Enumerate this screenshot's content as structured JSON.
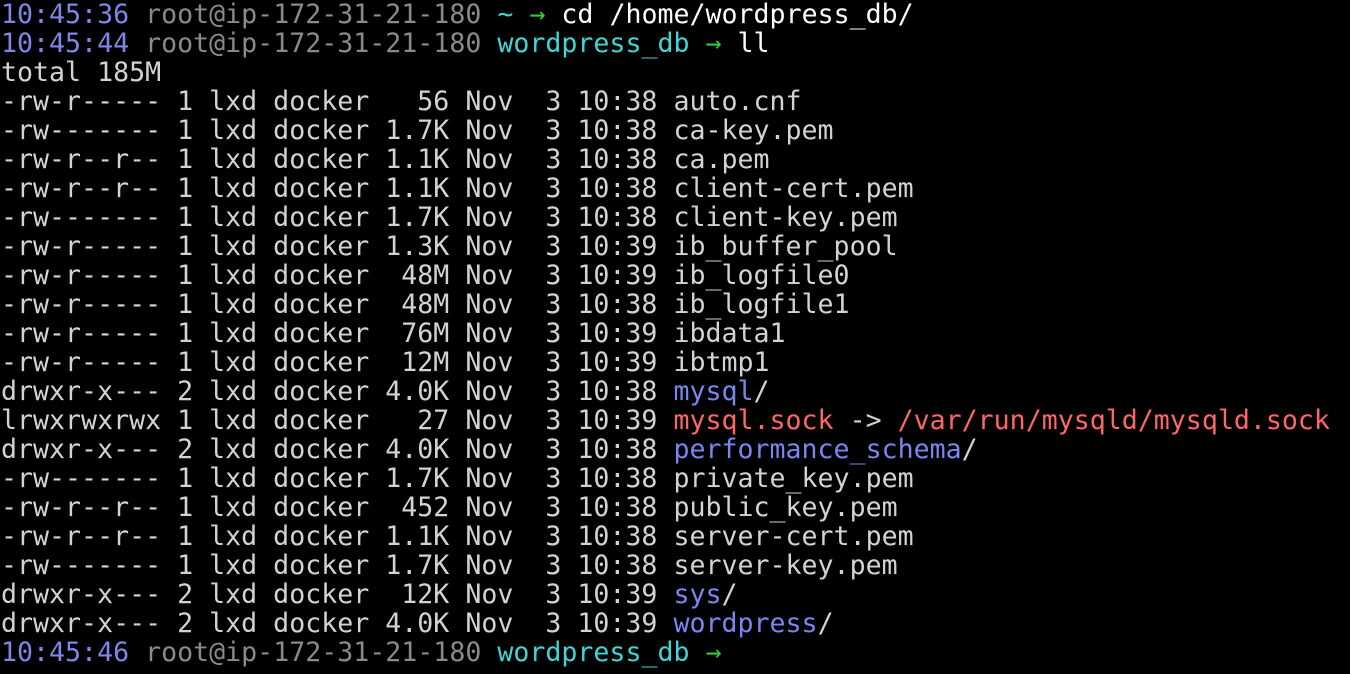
{
  "colors": {
    "background": "#000000",
    "text": "#d3d3d3",
    "time": "#7e86e8",
    "host": "#8a8a8a",
    "cwd": "#3fd6d6",
    "arrow": "#37c837",
    "directory": "#7a86f0",
    "symlink": "#ff6666"
  },
  "prompts": [
    {
      "time": "10:45:36",
      "host": "root@ip-172-31-21-180",
      "cwd": "~",
      "arrow": "→",
      "command": "cd /home/wordpress_db/"
    },
    {
      "time": "10:45:44",
      "host": "root@ip-172-31-21-180",
      "cwd": "wordpress_db",
      "arrow": "→",
      "command": "ll"
    },
    {
      "time": "10:45:46",
      "host": "root@ip-172-31-21-180",
      "cwd": "wordpress_db",
      "arrow": "→",
      "command": ""
    }
  ],
  "total_line": "total 185M",
  "listing": [
    {
      "meta": "-rw-r----- 1 lxd docker   56 Nov  3 10:38 ",
      "name": "auto.cnf",
      "kind": "file",
      "suffix": "",
      "target": ""
    },
    {
      "meta": "-rw------- 1 lxd docker 1.7K Nov  3 10:38 ",
      "name": "ca-key.pem",
      "kind": "file",
      "suffix": "",
      "target": ""
    },
    {
      "meta": "-rw-r--r-- 1 lxd docker 1.1K Nov  3 10:38 ",
      "name": "ca.pem",
      "kind": "file",
      "suffix": "",
      "target": ""
    },
    {
      "meta": "-rw-r--r-- 1 lxd docker 1.1K Nov  3 10:38 ",
      "name": "client-cert.pem",
      "kind": "file",
      "suffix": "",
      "target": ""
    },
    {
      "meta": "-rw------- 1 lxd docker 1.7K Nov  3 10:38 ",
      "name": "client-key.pem",
      "kind": "file",
      "suffix": "",
      "target": ""
    },
    {
      "meta": "-rw-r----- 1 lxd docker 1.3K Nov  3 10:39 ",
      "name": "ib_buffer_pool",
      "kind": "file",
      "suffix": "",
      "target": ""
    },
    {
      "meta": "-rw-r----- 1 lxd docker  48M Nov  3 10:39 ",
      "name": "ib_logfile0",
      "kind": "file",
      "suffix": "",
      "target": ""
    },
    {
      "meta": "-rw-r----- 1 lxd docker  48M Nov  3 10:38 ",
      "name": "ib_logfile1",
      "kind": "file",
      "suffix": "",
      "target": ""
    },
    {
      "meta": "-rw-r----- 1 lxd docker  76M Nov  3 10:39 ",
      "name": "ibdata1",
      "kind": "file",
      "suffix": "",
      "target": ""
    },
    {
      "meta": "-rw-r----- 1 lxd docker  12M Nov  3 10:39 ",
      "name": "ibtmp1",
      "kind": "file",
      "suffix": "",
      "target": ""
    },
    {
      "meta": "drwxr-x--- 2 lxd docker 4.0K Nov  3 10:38 ",
      "name": "mysql",
      "kind": "dir",
      "suffix": "/",
      "target": ""
    },
    {
      "meta": "lrwxrwxrwx 1 lxd docker   27 Nov  3 10:39 ",
      "name": "mysql.sock",
      "kind": "link",
      "suffix": " -> ",
      "target": "/var/run/mysqld/mysqld.sock"
    },
    {
      "meta": "drwxr-x--- 2 lxd docker 4.0K Nov  3 10:38 ",
      "name": "performance_schema",
      "kind": "dir",
      "suffix": "/",
      "target": ""
    },
    {
      "meta": "-rw------- 1 lxd docker 1.7K Nov  3 10:38 ",
      "name": "private_key.pem",
      "kind": "file",
      "suffix": "",
      "target": ""
    },
    {
      "meta": "-rw-r--r-- 1 lxd docker  452 Nov  3 10:38 ",
      "name": "public_key.pem",
      "kind": "file",
      "suffix": "",
      "target": ""
    },
    {
      "meta": "-rw-r--r-- 1 lxd docker 1.1K Nov  3 10:38 ",
      "name": "server-cert.pem",
      "kind": "file",
      "suffix": "",
      "target": ""
    },
    {
      "meta": "-rw------- 1 lxd docker 1.7K Nov  3 10:38 ",
      "name": "server-key.pem",
      "kind": "file",
      "suffix": "",
      "target": ""
    },
    {
      "meta": "drwxr-x--- 2 lxd docker  12K Nov  3 10:39 ",
      "name": "sys",
      "kind": "dir",
      "suffix": "/",
      "target": ""
    },
    {
      "meta": "drwxr-x--- 2 lxd docker 4.0K Nov  3 10:39 ",
      "name": "wordpress",
      "kind": "dir",
      "suffix": "/",
      "target": ""
    }
  ]
}
